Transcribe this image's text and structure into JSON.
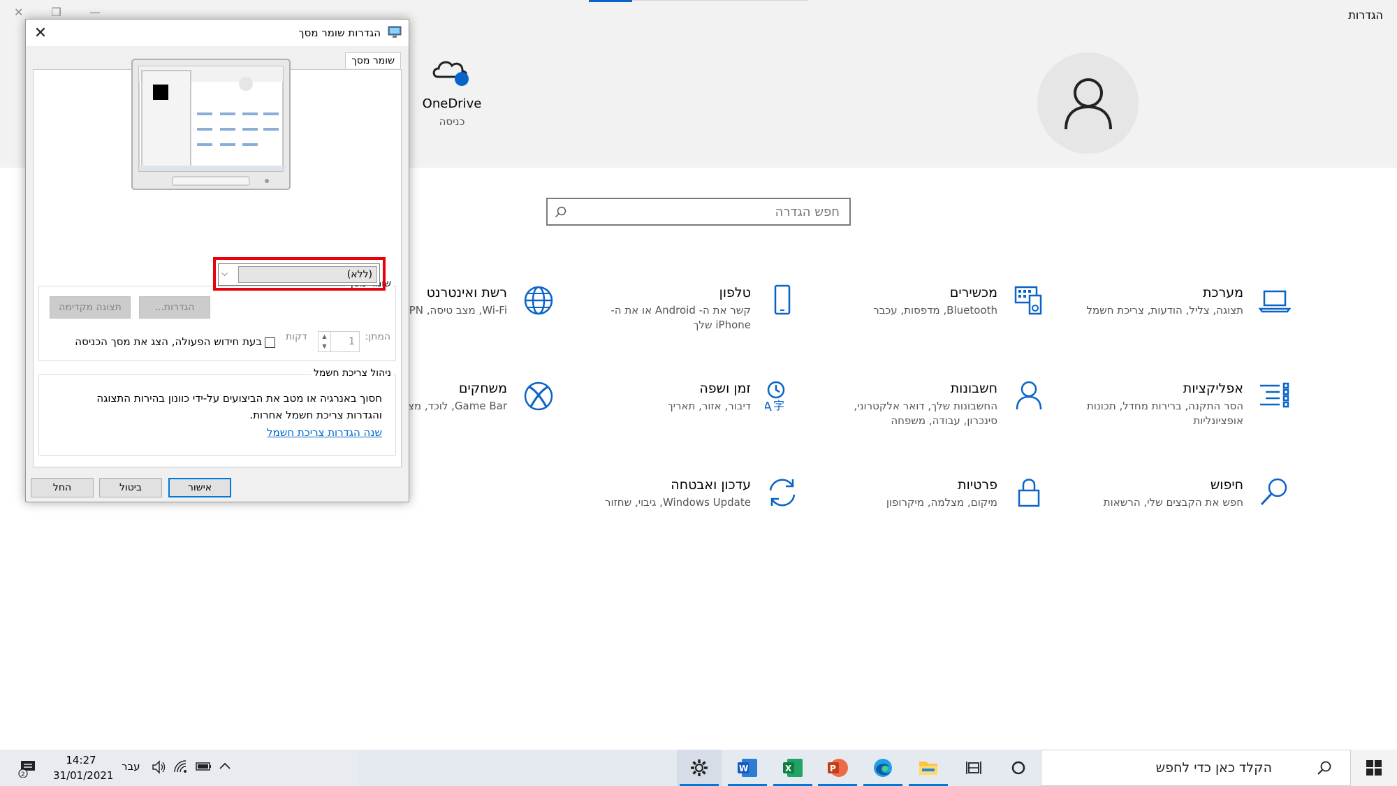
{
  "settings": {
    "window_title": "הגדרות",
    "search_placeholder": "חפש הגדרה",
    "onedrive": {
      "name": "OneDrive",
      "sub": "כניסה"
    },
    "tiles": [
      {
        "id": "system",
        "title": "מערכת",
        "desc": "תצוגה, צליל, הודעות, צריכת חשמל",
        "icon": "laptop-icon"
      },
      {
        "id": "devices",
        "title": "מכשירים",
        "desc": "Bluetooth, מדפסות, עכבר",
        "icon": "keyboard-icon"
      },
      {
        "id": "phone",
        "title": "טלפון",
        "desc": "קשר את ה- Android או את ה- iPhone שלך",
        "icon": "phone-icon"
      },
      {
        "id": "network",
        "title": "רשת ואינטרנט",
        "desc": "Wi-Fi, מצב טיסה, VPN",
        "icon": "globe-icon"
      },
      {
        "id": "apps",
        "title": "אפליקציות",
        "desc": "הסר התקנה, ברירות מחדל, תכונות אופציונליות",
        "icon": "apps-list-icon"
      },
      {
        "id": "accounts",
        "title": "חשבונות",
        "desc": "החשבונות שלך, דואר אלקטרוני, סינכרון, עבודה, משפחה",
        "icon": "person-icon"
      },
      {
        "id": "time",
        "title": "זמן ושפה",
        "desc": "דיבור, אזור, תאריך",
        "icon": "time-language-icon"
      },
      {
        "id": "gaming",
        "title": "משחקים",
        "desc": "Game Bar, לוכד, מצב משחק",
        "icon": "xbox-icon"
      },
      {
        "id": "search",
        "title": "חיפוש",
        "desc": "חפש את הקבצים שלי, הרשאות",
        "icon": "search-icon"
      },
      {
        "id": "privacy",
        "title": "פרטיות",
        "desc": "מיקום, מצלמה, מיקרופון",
        "icon": "lock-icon"
      },
      {
        "id": "update",
        "title": "עדכון ואבטחה",
        "desc": "Windows Update, גיבוי, שחזור",
        "icon": "sync-icon"
      }
    ]
  },
  "dialog": {
    "title": "הגדרות שומר מסך",
    "tab_label": "שומר מסך",
    "screensaver_group": "שומר מסך",
    "screensaver_selected": "(ללא)",
    "settings_button": "הגדרות...",
    "preview_button": "תצוגה מקדימה",
    "wait_label": "המתן:",
    "wait_value": "1",
    "minutes_label": "דקות",
    "resume_label": "בעת חידוש הפעולה, הצג את מסך הכניסה",
    "resume_checked": false,
    "power_group": "ניהול צריכת חשמל",
    "power_text": "חסוך באנרגיה או מטב את הביצועים על-ידי כוונון בהירות התצוגה והגדרות צריכת חשמל אחרות.",
    "power_link": "שנה הגדרות צריכת חשמל",
    "ok_button": "אישור",
    "cancel_button": "ביטול",
    "apply_button": "החל"
  },
  "taskbar": {
    "search_text": "הקלד כאן כדי לחפש",
    "time": "14:27",
    "date": "31/01/2021",
    "language": "עבר",
    "notification_count": "2"
  },
  "colors": {
    "accent": "#0078d7",
    "highlight": "#e8000b",
    "icon_blue": "#0a64c8"
  }
}
